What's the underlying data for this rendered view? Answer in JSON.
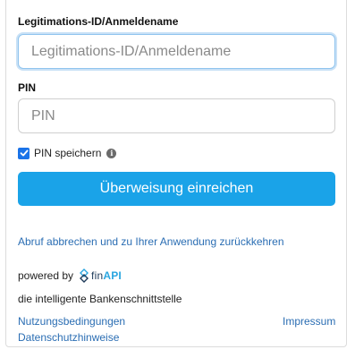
{
  "login": {
    "id_label": "Legitimations-ID/Anmeldename",
    "id_placeholder": "Legitimations-ID/Anmeldename",
    "pin_label": "PIN",
    "pin_placeholder": "PIN",
    "save_pin_label": "PIN speichern",
    "save_pin_checked": true,
    "submit_label": "Überweisung einreichen"
  },
  "links": {
    "abort": "Abruf abbrechen und zu Ihrer Anwendung zurückkehren",
    "terms": "Nutzungsbedingungen",
    "imprint": "Impressum",
    "privacy": "Datenschutzhinweise"
  },
  "branding": {
    "powered_by": "powered by",
    "logo_fin": "fin",
    "logo_api": "API",
    "tagline": "die intelligente Bankenschnittstelle"
  },
  "colors": {
    "accent": "#1aa3e8",
    "link": "#2a6db3",
    "checkbox": "#1a73e8"
  },
  "icons": {
    "info": "info-icon",
    "check": "check-icon",
    "logo": "finapi-logo-icon"
  }
}
